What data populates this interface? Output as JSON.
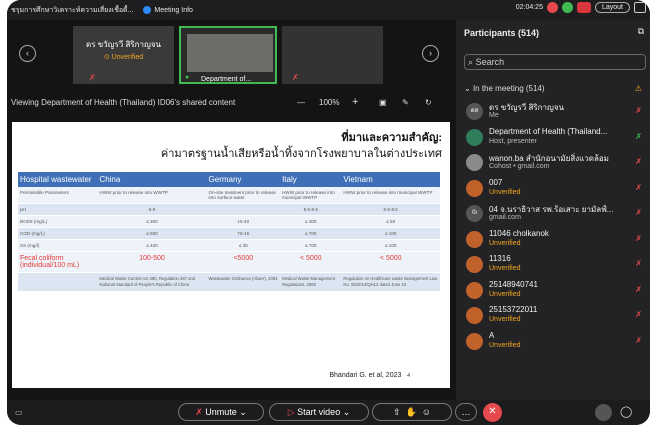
{
  "topbar": {
    "title": "ชรุมการศึกษาวิเคราะห์ความเสี่ยงเชื้อดื้...",
    "meeting_label": "Meeting Info",
    "time": "02:04:25",
    "layout_label": "Layout"
  },
  "thumbnails": {
    "person_name": "ดร ขวัญรวี สิริกาญจน",
    "unverified": "Unverified",
    "room_label": "Department of..."
  },
  "sharebar": {
    "text": "Viewing Department of Health (Thailand) ID06's shared content",
    "zoom": "100%",
    "minus": "—",
    "plus": "+"
  },
  "slide": {
    "title_line1": "ที่มาและความสำคัญ:",
    "title_line2": "ค่ามาตรฐานน้ำเสียหรือน้ำทิ้งจากโรงพยาบาลในต่างประเทศ",
    "headers": [
      "Hospital wastewater",
      "China",
      "Germany",
      "Italy",
      "Vietnam"
    ],
    "rows": [
      [
        "Permissible Parameters",
        "HWW prior to release into WWTP",
        "On-site treatment prior to release into surface water",
        "HWW prior to release into municipal WWTP",
        "HWW prior to release into municipal WWTP"
      ],
      [
        "pH",
        "6-9",
        "",
        "5.5-9.5",
        "6.5-8.5"
      ],
      [
        "BOD5 (mg/L)",
        "≤ 300",
        "15-40",
        "≤ 300",
        "≤ 50"
      ],
      [
        "COD (mg/L)",
        "≤ 500",
        "75-15",
        "≤ 700",
        "≤ 100"
      ],
      [
        "SS (mg/l)",
        "≤ 400",
        "≤ 35",
        "≤ 700",
        "≤ 100"
      ]
    ],
    "fecal_row": [
      "Fecal coliform (individual/100 mL)",
      "100-500",
      "<5000",
      "< 5000",
      "< 5000"
    ],
    "reg_row": [
      "",
      "Medical Waste Control Act 380, Regulation 287 and National Standard of People's Republic of China",
      "Wastewater Ordinance (AbwV), 2004",
      "Medical Waste Management Regulations, 2008",
      "Regulation on Healthcare waste Management Law No. 55/2014/QH13 dated June 23"
    ],
    "citation": "Bhandari G. et al, 2023",
    "page": "4"
  },
  "participants": {
    "header": "Participants (514)",
    "search_placeholder": "Search",
    "section_label": "In the meeting (514)",
    "list": [
      {
        "initials": "ดส",
        "name": "ดร ขวัญรวี สิริกาญจน",
        "sub": "Me",
        "sub_color": "#bbbbbb",
        "avatar": "#555555"
      },
      {
        "initials": "",
        "name": "Department of Health (Thailand...",
        "sub": "Host, presenter",
        "sub_color": "#bbbbbb",
        "avatar": "#2e7d5b"
      },
      {
        "initials": "",
        "name": "wanon.ba สำนักอนามัยสิ่งแวดล้อม",
        "sub": "Cohost • gmail.com",
        "sub_color": "#bbbbbb",
        "avatar": "#8a8a8a"
      },
      {
        "initials": "",
        "name": "007",
        "sub": "Unverified",
        "sub_color": "#f5a623",
        "avatar": "#c0622a"
      },
      {
        "initials": "0ι",
        "name": "04 จ.นราธิวาส รพ.ร้อเสาะ ยามัลฟ์...",
        "sub": "gmail.com",
        "sub_color": "#bbbbbb",
        "avatar": "#555555"
      },
      {
        "initials": "",
        "name": "11046 cholkanok",
        "sub": "Unverified",
        "sub_color": "#f5a623",
        "avatar": "#c0622a"
      },
      {
        "initials": "",
        "name": "11316",
        "sub": "Unverified",
        "sub_color": "#f5a623",
        "avatar": "#c0622a"
      },
      {
        "initials": "",
        "name": "25148940741",
        "sub": "Unverified",
        "sub_color": "#f5a623",
        "avatar": "#c0622a"
      },
      {
        "initials": "",
        "name": "25153722011",
        "sub": "Unverified",
        "sub_color": "#f5a623",
        "avatar": "#c0622a"
      },
      {
        "initials": "",
        "name": "A",
        "sub": "Unverified",
        "sub_color": "#f5a623",
        "avatar": "#c0622a"
      }
    ]
  },
  "bottombar": {
    "unmute": "Unmute",
    "start_video": "Start video"
  }
}
